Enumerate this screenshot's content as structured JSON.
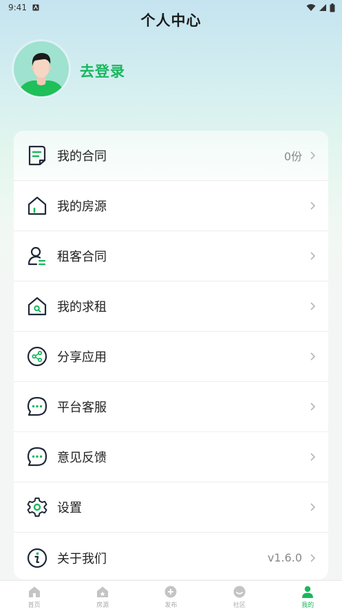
{
  "status_bar": {
    "time": "9:41"
  },
  "header": {
    "title": "个人中心"
  },
  "profile": {
    "login_label": "去登录"
  },
  "menu": [
    {
      "key": "contracts",
      "label": "我的合同",
      "value": "0份",
      "icon": "document-icon"
    },
    {
      "key": "listings",
      "label": "我的房源",
      "value": "",
      "icon": "house-icon"
    },
    {
      "key": "tenant_contracts",
      "label": "租客合同",
      "value": "",
      "icon": "person-list-icon"
    },
    {
      "key": "rent_requests",
      "label": "我的求租",
      "value": "",
      "icon": "house-search-icon"
    },
    {
      "key": "share",
      "label": "分享应用",
      "value": "",
      "icon": "share-icon"
    },
    {
      "key": "support",
      "label": "平台客服",
      "value": "",
      "icon": "chat-bubble-icon"
    },
    {
      "key": "feedback",
      "label": "意见反馈",
      "value": "",
      "icon": "chat-bubble-icon"
    },
    {
      "key": "settings",
      "label": "设置",
      "value": "",
      "icon": "gear-icon"
    },
    {
      "key": "about",
      "label": "关于我们",
      "value": "v1.6.0",
      "icon": "info-icon"
    }
  ],
  "tabs": [
    {
      "label": "首页",
      "icon": "home-icon",
      "active": false
    },
    {
      "label": "房源",
      "icon": "house-star-icon",
      "active": false
    },
    {
      "label": "发布",
      "icon": "plus-circle-icon",
      "active": false
    },
    {
      "label": "社区",
      "icon": "chat-circle-icon",
      "active": false
    },
    {
      "label": "我的",
      "icon": "person-icon",
      "active": true
    }
  ],
  "colors": {
    "accent": "#18b85e",
    "icon_dark": "#1f2937",
    "tab_inactive": "#aaaaaa"
  }
}
